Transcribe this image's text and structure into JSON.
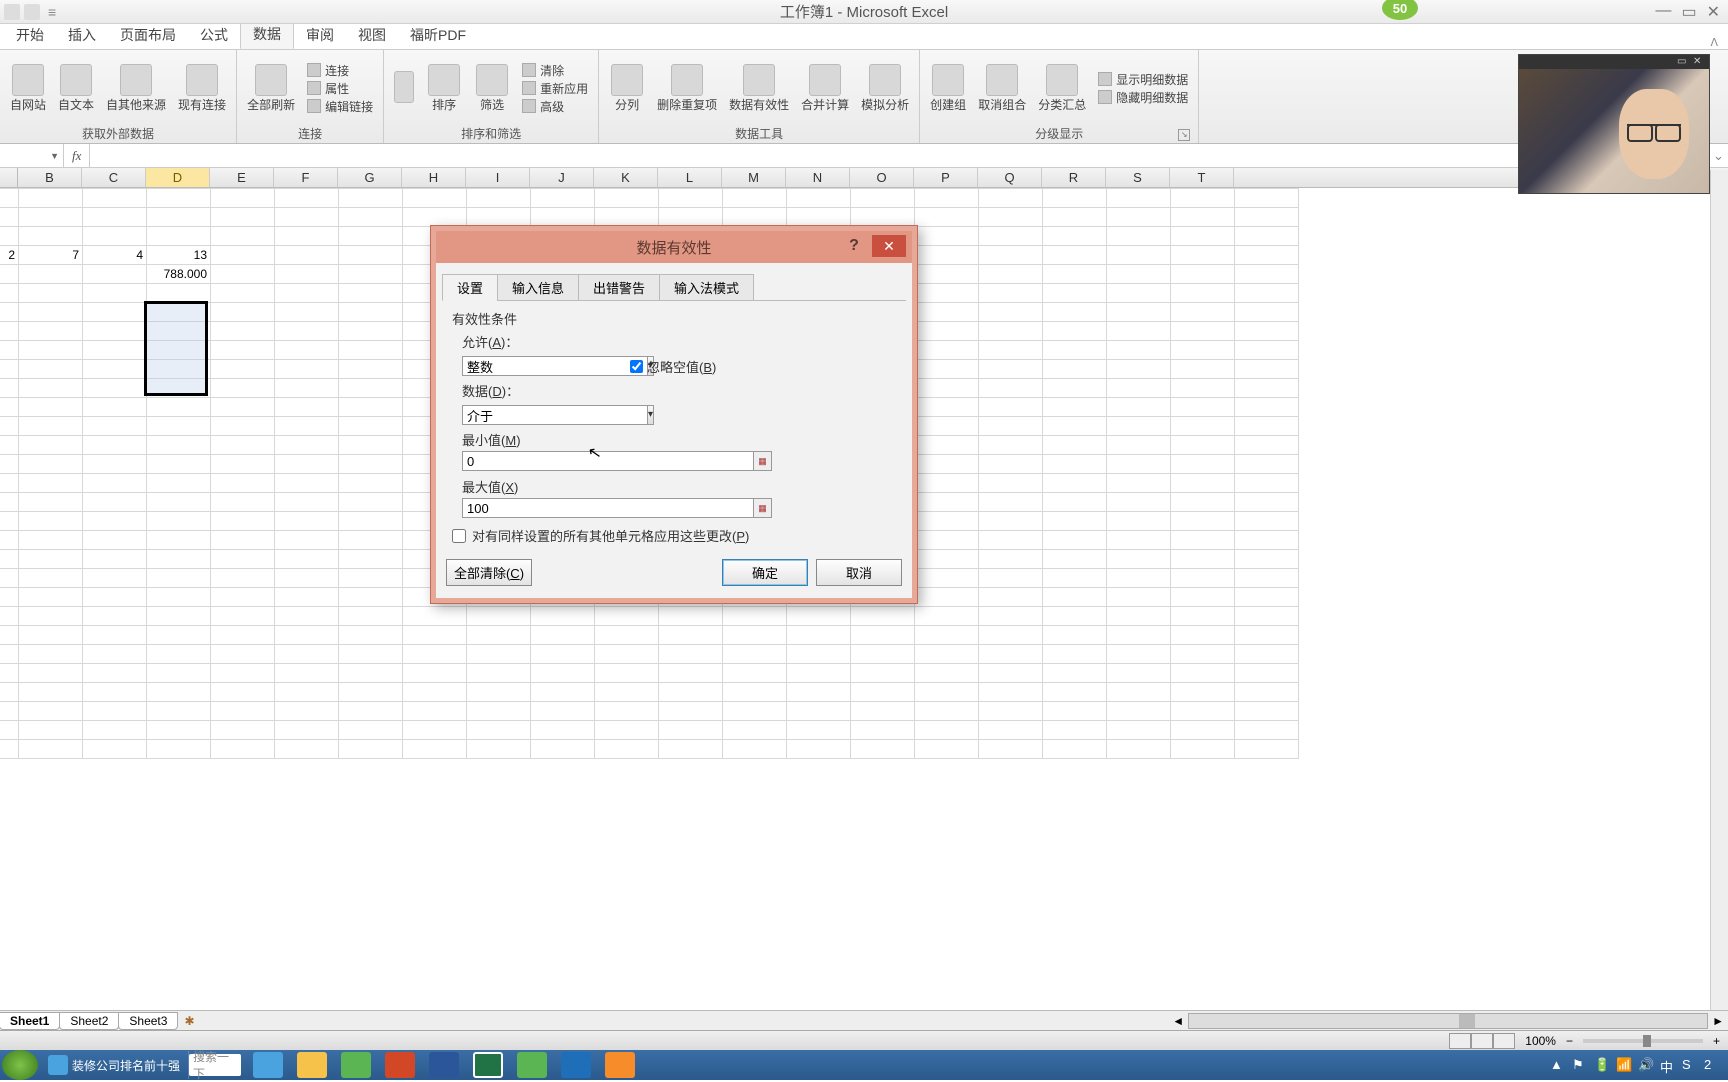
{
  "window": {
    "title": "工作簿1 - Microsoft Excel",
    "badge": "50"
  },
  "ribbon": {
    "tabs": [
      "开始",
      "插入",
      "页面布局",
      "公式",
      "数据",
      "审阅",
      "视图",
      "福昕PDF"
    ],
    "active_tab": "数据",
    "groups": {
      "ext_data": {
        "label": "获取外部数据",
        "items": [
          "自网站",
          "自文本",
          "自其他来源",
          "现有连接"
        ]
      },
      "connections": {
        "label": "连接",
        "refresh": "全部刷新",
        "items": [
          "连接",
          "属性",
          "编辑链接"
        ]
      },
      "sort_filter": {
        "label": "排序和筛选",
        "sort": "排序",
        "filter": "筛选",
        "items": [
          "清除",
          "重新应用",
          "高级"
        ]
      },
      "data_tools": {
        "label": "数据工具",
        "items": [
          "分列",
          "删除重复项",
          "数据有效性",
          "合并计算",
          "模拟分析"
        ]
      },
      "outline": {
        "label": "分级显示",
        "items": [
          "创建组",
          "取消组合",
          "分类汇总"
        ],
        "extra": [
          "显示明细数据",
          "隐藏明细数据"
        ]
      }
    }
  },
  "formula_bar": {
    "namebox": "",
    "fx": "fx",
    "formula": ""
  },
  "columns": [
    "B",
    "C",
    "D",
    "E",
    "F",
    "G",
    "H",
    "I",
    "J",
    "K",
    "L",
    "M",
    "N",
    "O",
    "P",
    "Q",
    "R",
    "S",
    "T"
  ],
  "selected_col": "D",
  "cells": {
    "A2": "2",
    "B2": "7",
    "C2": "4",
    "D2": "13",
    "D3": "788.000"
  },
  "sheets": [
    "Sheet1",
    "Sheet2",
    "Sheet3"
  ],
  "active_sheet": "Sheet1",
  "statusbar": {
    "zoom": "100%"
  },
  "dialog": {
    "title": "数据有效性",
    "tabs": [
      "设置",
      "输入信息",
      "出错警告",
      "输入法模式"
    ],
    "active_tab": "设置",
    "section": "有效性条件",
    "allow_label": "允许(A)：",
    "allow_value": "整数",
    "ignore_blank": "忽略空值(B)",
    "data_label": "数据(D)：",
    "data_value": "介于",
    "min_label": "最小值(M)",
    "min_value": "0",
    "max_label": "最大值(X)",
    "max_value": "100",
    "apply_all": "对有同样设置的所有其他单元格应用这些更改(P)",
    "clear_all": "全部清除(C)",
    "ok": "确定",
    "cancel": "取消"
  },
  "taskbar": {
    "ie_title": "装修公司排名前十强",
    "search_placeholder": "搜索一下"
  }
}
